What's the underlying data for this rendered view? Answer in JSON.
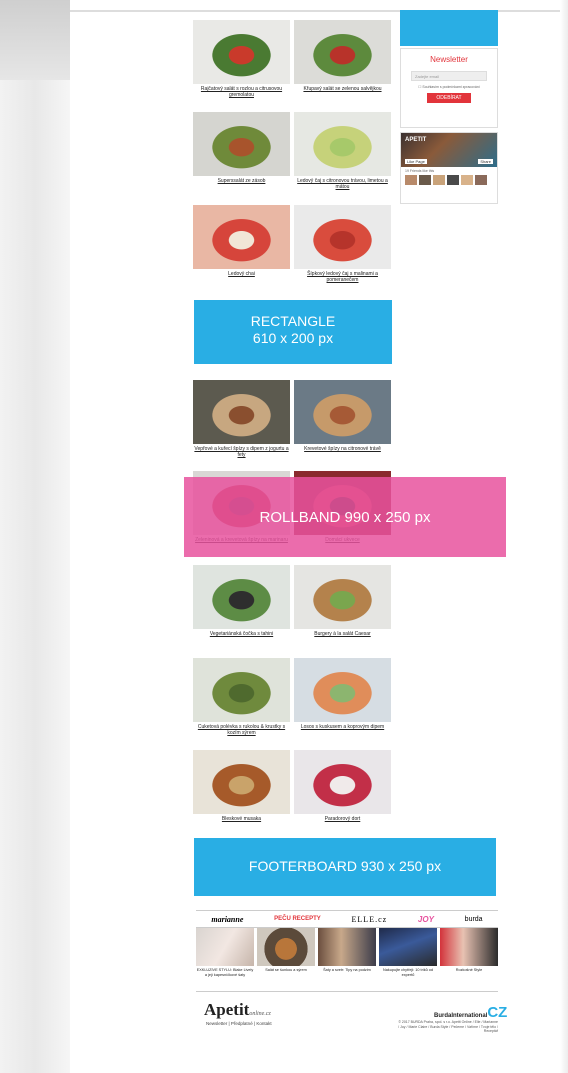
{
  "recipes": [
    {
      "caption": "Rajčatový salát s rozlou a citrusovou gremolatou",
      "colors": [
        "#e9e9e6",
        "#4a7a32",
        "#c93a2b"
      ]
    },
    {
      "caption": "Křupavý salát se zelenou salvějkou",
      "colors": [
        "#dcdcd8",
        "#5d8a3d",
        "#b8332a"
      ]
    },
    {
      "caption": "Superssalát ze zásob",
      "colors": [
        "#d5d5d0",
        "#6f8a3a",
        "#a8542c"
      ]
    },
    {
      "caption": "Ledový čaj s citronovou trávou, limetou a mátou",
      "colors": [
        "#e6e8e3",
        "#c6d27a",
        "#a7c96a"
      ]
    },
    {
      "caption": "Ledový chai",
      "colors": [
        "#e9b7a4",
        "#d6453b",
        "#f1e6d7"
      ]
    },
    {
      "caption": "Šípkový ledový čaj s malinami a pomeranečem",
      "colors": [
        "#eaeaea",
        "#d94c3d",
        "#b6342b"
      ]
    },
    {
      "caption": "Vepřové a kuřecí špízy s dipem z jogurtu a fety",
      "colors": [
        "#5c5a4f",
        "#c7a780",
        "#8a4f2f"
      ]
    },
    {
      "caption": "Krevetové špízy na citronové trávě",
      "colors": [
        "#6b7a86",
        "#c69a6a",
        "#a65a36"
      ]
    },
    {
      "caption": "Zeleninová a krevetová špízy na marinaru",
      "colors": [
        "#d9d7d5",
        "#b53a3a",
        "#6d3a45"
      ]
    },
    {
      "caption": "Domácí ukvece",
      "colors": [
        "#8a2a2e",
        "#d14b4e",
        "#3b2a2a"
      ]
    },
    {
      "caption": "Vegetariánská čočka s tahini",
      "colors": [
        "#dfe4df",
        "#5d8c45",
        "#2e2e2e"
      ]
    },
    {
      "caption": "Burgery à la salát Caesar",
      "colors": [
        "#e5e5e2",
        "#b4824c",
        "#7aa64e"
      ]
    },
    {
      "caption": "Cuketová polévka s rukolou & krustky s kozím sýrem",
      "colors": [
        "#dfe3da",
        "#6f8a3d",
        "#4f6a2e"
      ]
    },
    {
      "caption": "Losos s kuskusem a koprovým dipem",
      "colors": [
        "#d6dde3",
        "#e08d5a",
        "#8cb56f"
      ]
    },
    {
      "caption": "Bleskové musaka",
      "colors": [
        "#e8e3d8",
        "#a65a2a",
        "#c9a36a"
      ]
    },
    {
      "caption": "Paradorový dort",
      "colors": [
        "#e9e6e9",
        "#c22f48",
        "#f0eaea"
      ]
    }
  ],
  "ads": {
    "rectangle": {
      "line1": "RECTANGLE",
      "line2": "610 x 200 px",
      "color": "#29aee4"
    },
    "rollband": {
      "text": "ROLLBAND 990 x 250 px",
      "color": "#e7529e"
    },
    "footerboard": {
      "text": "FOOTERBOARD 930 x 250 px",
      "color": "#29aee4"
    }
  },
  "newsletter": {
    "title": "Newsletter",
    "email_placeholder": "Zadejte email",
    "checkbox_label": "Souhlasím s podmínkami zpracování",
    "submit_label": "ODEBÍRAT"
  },
  "facebook": {
    "page": "APETIT",
    "like": "Like Page",
    "share": "Share",
    "followers": "19 Friends like this"
  },
  "partner_logos": [
    "marianne",
    "PEČU RECEPTY",
    "ELLE.cz",
    "JOY",
    "burda"
  ],
  "partner_articles": [
    {
      "caption": "EXKLUZIVE STYLU: Blake Lively a její kapesníčkové šaty"
    },
    {
      "caption": "Salát se šunkou a sýrem"
    },
    {
      "caption": "Šaty a svetr: Tipy na podzim"
    },
    {
      "caption": "Nakupujte chytřeji: 10 triků od expertů"
    },
    {
      "caption": "Rozkošné Style"
    }
  ],
  "footer": {
    "logo": "Apetit",
    "logo_suffix": "online.cz",
    "links": "Newsletter | Předplatné | Kontakt",
    "publisher": "BurdaInternational",
    "publisher_mark": "CZ",
    "copyright": "© 2017 BURDA Praha, spol. s r.o. Apetit Online / Elle / Marianne / Joy / Marie Claire / Burda Style / Pečeme / Vaříme / Tvoje tělo / Receptář"
  }
}
